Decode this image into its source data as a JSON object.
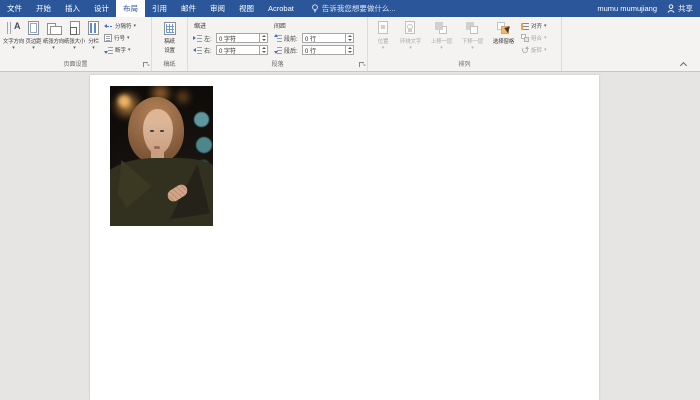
{
  "titlebar": {
    "tabs": [
      {
        "label": "文件"
      },
      {
        "label": "开始"
      },
      {
        "label": "插入"
      },
      {
        "label": "设计"
      },
      {
        "label": "布局",
        "active": true
      },
      {
        "label": "引用"
      },
      {
        "label": "邮件"
      },
      {
        "label": "审阅"
      },
      {
        "label": "视图"
      },
      {
        "label": "Acrobat"
      }
    ],
    "tell_me": "告诉我您想要做什么...",
    "user_name": "mumu mumujiang",
    "share_label": "共享"
  },
  "ribbon": {
    "page_setup": {
      "group_label": "页面设置",
      "buttons": [
        {
          "label": "文字方向"
        },
        {
          "label": "页边距"
        },
        {
          "label": "纸张方向"
        },
        {
          "label": "纸张大小"
        },
        {
          "label": "分栏"
        }
      ],
      "small_buttons": [
        {
          "label": "分隔符"
        },
        {
          "label": "行号"
        },
        {
          "label": "断字"
        }
      ]
    },
    "manuscript": {
      "group_label": "稿纸",
      "button_line1": "稿纸",
      "button_line2": "设置"
    },
    "paragraph": {
      "group_label": "段落",
      "indent_header": "缩进",
      "spacing_header": "间距",
      "indent_left_label": "左:",
      "indent_right_label": "右:",
      "before_label": "段前:",
      "after_label": "段后:",
      "indent_left_value": "0 字符",
      "indent_right_value": "0 字符",
      "before_value": "0 行",
      "after_value": "0 行"
    },
    "arrange": {
      "group_label": "排列",
      "buttons": [
        {
          "label": "位置",
          "disabled": true
        },
        {
          "label": "环绕文字",
          "disabled": true
        },
        {
          "label": "上移一层",
          "disabled": true
        },
        {
          "label": "下移一层",
          "disabled": true
        },
        {
          "label": "选择窗格",
          "disabled": false
        }
      ],
      "small_buttons": [
        {
          "label": "对齐",
          "disabled": false
        },
        {
          "label": "组合",
          "disabled": true
        },
        {
          "label": "旋转",
          "disabled": true
        }
      ]
    }
  },
  "document": {
    "image": "woman-portrait-photo"
  },
  "colors": {
    "titlebar_blue": "#2b579a",
    "ribbon_bg": "#f4f3f2",
    "doc_bg": "#e6e5e4",
    "accent_blue": "#4472c4",
    "selection_orange": "#f5b66e",
    "disabled_gray": "#aaa8a6"
  }
}
